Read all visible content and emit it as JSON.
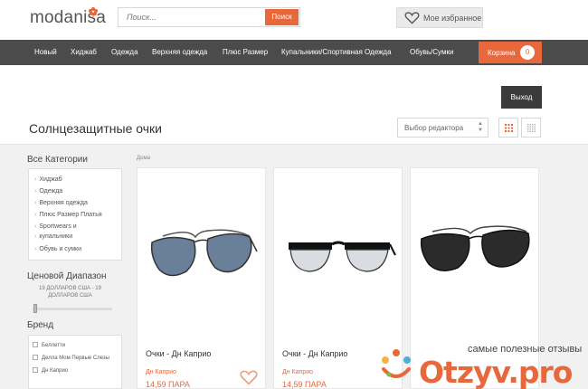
{
  "header": {
    "logo": "modanisa",
    "search_placeholder": "Поиск...",
    "search_button": "Поиск",
    "favorites_label": "Мое избранное"
  },
  "nav": {
    "items": [
      "Новый",
      "Хиджаб",
      "Одежда",
      "Верхняя одежда",
      "Плюс Размер",
      "Купальники/Спортивная Одежда",
      "Обувь/Сумки"
    ],
    "cart_label": "Корзина",
    "cart_count": "0",
    "logout_label": "Выход"
  },
  "page": {
    "title": "Солнцезащитные очки",
    "sort_label": "Выбор редактора",
    "breadcrumb": "Дома"
  },
  "sidebar": {
    "categories_title": "Все Категории",
    "categories": [
      "Хиджаб",
      "Одежда",
      "Верхняя одежда",
      "Плюс Размер Платья",
      "Sportwears и",
      "купальники",
      "Обувь и сумки"
    ],
    "price_title": "Ценовой Диапазон",
    "price_range": "19 ДОЛЛАРОВ США - 19 ДОЛЛАРОВ США",
    "brand_title": "Бренд",
    "brands": [
      "Беллетти",
      "Делла Мом Первые Слезы",
      "Дн Каприо"
    ]
  },
  "products": [
    {
      "name": "Очки - Дн Каприо",
      "brand": "Дн Каприо",
      "price": "14,59 ПАРА"
    },
    {
      "name": "Очки - Дн Каприо",
      "brand": "Дн Каприо",
      "price": "14,59 ПАРА"
    },
    {
      "name": "",
      "brand": "",
      "price": ""
    }
  ],
  "watermark": {
    "tagline": "самые полезные отзывы",
    "brand": "Otzyv.pro"
  },
  "colors": {
    "accent": "#e8683b",
    "nav_bg": "#4b4b4b",
    "page_bg": "#f1f1f1"
  }
}
